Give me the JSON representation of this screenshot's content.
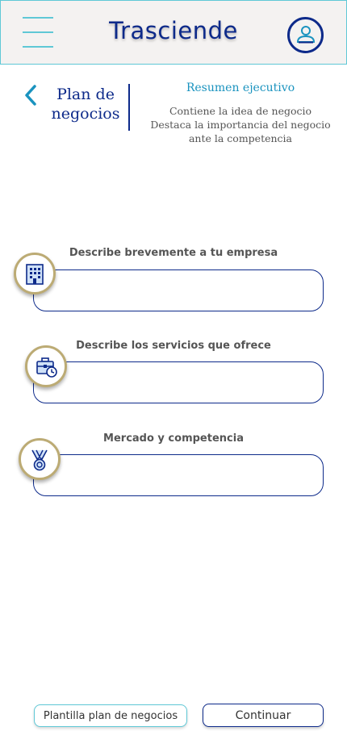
{
  "header": {
    "app_title": "Trasciende",
    "menu_icon": "hamburger-icon",
    "profile_icon": "user-icon"
  },
  "section": {
    "back_icon": "chevron-left-icon",
    "title": "Plan de negocios",
    "summary_title": "Resumen ejecutivo",
    "summary_lines": [
      "Contiene la idea de negocio",
      "Destaca la importancia del negocio",
      "ante la competencia"
    ]
  },
  "fields": [
    {
      "label": "Describe brevemente a tu empresa",
      "value": "",
      "placeholder": "",
      "icon": "building-icon"
    },
    {
      "label": "Describe los servicios que ofrece",
      "value": "",
      "placeholder": "",
      "icon": "briefcase-clock-icon"
    },
    {
      "label": "Mercado y competencia",
      "value": "",
      "placeholder": "",
      "icon": "medal-icon"
    }
  ],
  "footer": {
    "template_label": "Plantilla plan de negocios",
    "continue_label": "Continuar"
  },
  "colors": {
    "primary": "#0d2a8a",
    "accent": "#5fc8d6",
    "summary": "#1a93bf",
    "badge_border": "#bcab74",
    "header_bg": "#f4f2f1"
  }
}
